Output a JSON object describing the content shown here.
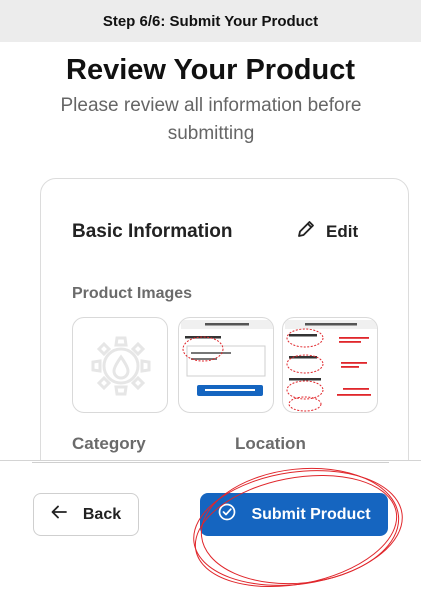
{
  "header": {
    "step_title": "Step 6/6: Submit Your Product"
  },
  "review": {
    "title": "Review Your Product",
    "subtitle": "Please review all information before submitting"
  },
  "card": {
    "section_title": "Basic Information",
    "edit_label": "Edit",
    "images_label": "Product Images",
    "category_label": "Category",
    "location_label": "Location",
    "images": [
      {
        "kind": "placeholder",
        "icon": "gear-drop-icon"
      },
      {
        "kind": "screenshot",
        "icon": "form-screenshot"
      },
      {
        "kind": "screenshot",
        "icon": "annotated-screenshot"
      }
    ]
  },
  "footer": {
    "back_label": "Back",
    "submit_label": "Submit Product"
  },
  "colors": {
    "primary": "#1565c0",
    "annotation_red": "#e0262b",
    "step_bar_bg": "#ececec"
  }
}
